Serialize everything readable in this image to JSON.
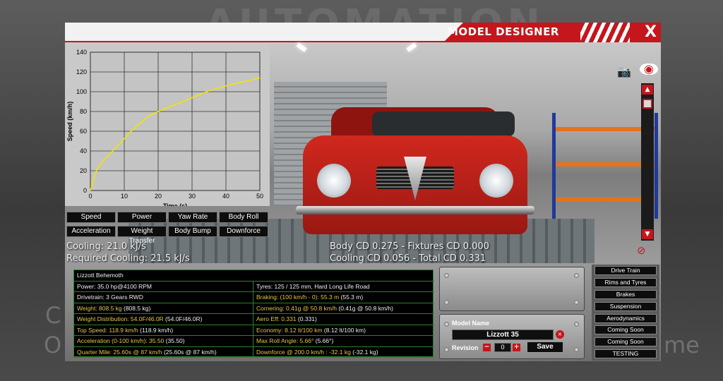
{
  "background": {
    "title": "AUTOMATION",
    "left_fragment_1": "C",
    "left_fragment_2": "O",
    "right_fragment": "me"
  },
  "window": {
    "title": "MODEL DESIGNER",
    "close_label": "X"
  },
  "graph_buttons": [
    "Speed",
    "Power",
    "Yaw Rate",
    "Body Roll",
    "Acceleration",
    "Weight Transfer",
    "Body Bump",
    "Downforce"
  ],
  "stats": {
    "cooling": "Cooling: 21.0 kJ/s",
    "required_cooling": "Required Cooling: 21.5 kJ/s",
    "body_cd": "Body CD 0.275 - Fixtures CD 0.000",
    "cooling_cd": "Cooling CD 0.056 - Total CD 0.331"
  },
  "info": {
    "name": "Lizzott Behemoth",
    "rows": [
      {
        "l_key": "Power:",
        "l_val": " 35.0 hp@4100 RPM",
        "l_hl": false,
        "r_key": "Tyres:",
        "r_val": " 125 / 125 mm, Hard Long Life Road",
        "r_hl": false
      },
      {
        "l_key": "Drivetrain:",
        "l_val": " 3 Gears RWD",
        "l_hl": false,
        "r_key": "Braking: (100 km/h - 0): 55.3 m",
        "r_val": " (55.3 m)",
        "r_hl": true
      },
      {
        "l_key": "Weight: 808.5 kg",
        "l_val": " (808.5 kg)",
        "l_hl": true,
        "r_key": "Cornering: 0.41g @ 50.8 km/h",
        "r_val": " (0.41g @ 50.8 km/h)",
        "r_hl": true
      },
      {
        "l_key": "Weight Distribution: 54.0F/46.0R",
        "l_val": " (54.0F/46.0R)",
        "l_hl": true,
        "r_key": "Aero Eff: 0.331",
        "r_val": " (0.331)",
        "r_hl": true
      },
      {
        "l_key": "Top Speed: 118.9 km/h",
        "l_val": " (118.9 km/h)",
        "l_hl": true,
        "r_key": "Economy: 8.12 lt/100 km",
        "r_val": " (8.12 lt/100 km)",
        "r_hl": true
      },
      {
        "l_key": "Acceleration (0-100 km/h): 35.50",
        "l_val": " (35.50)",
        "l_hl": true,
        "r_key": "Max Roll Angle: 5.66°",
        "r_val": " (5.66°)",
        "r_hl": true
      },
      {
        "l_key": "Quarter Mile: 25.60s @ 87 km/h",
        "l_val": " (25.60s @ 87 km/h)",
        "l_hl": true,
        "r_key": "Downforce @ 200.0 km/h : -32.1 kg",
        "r_val": " (-32.1 kg)",
        "r_hl": true
      }
    ]
  },
  "model": {
    "name_label": "Model Name",
    "name_value": "Lizzott 35",
    "revision_label": "Revision",
    "revision_value": "0",
    "minus": "−",
    "plus": "+",
    "save_label": "Save",
    "clear": "×"
  },
  "right_menu": [
    "Drive Train",
    "Rims and Tyres",
    "Brakes",
    "Suspension",
    "Aerodynamics",
    "Coming Soon",
    "Coming Soon",
    "TESTING"
  ],
  "icons": {
    "camera": "camera-icon",
    "eye": "eye-icon",
    "hide": "hide-icon",
    "scroll_up": "▲",
    "scroll_down": "▼"
  },
  "colors": {
    "accent": "#c4161c",
    "graph_line": "#f2e500",
    "table_key": "#e4c64a",
    "table_border": "#2f7f2f"
  },
  "chart_data": {
    "type": "line",
    "xlabel": "Time (s)",
    "ylabel": "Speed (km/h)",
    "xlim": [
      0,
      50
    ],
    "ylim": [
      0,
      140
    ],
    "xticks": [
      0,
      10,
      20,
      30,
      40,
      50
    ],
    "yticks": [
      0,
      20,
      40,
      60,
      80,
      100,
      120,
      140
    ],
    "grid": true,
    "series": [
      {
        "x": [
          0,
          1,
          2,
          4,
          8,
          12,
          17,
          20,
          25,
          30,
          35,
          40,
          45,
          50
        ],
        "y": [
          0,
          12,
          22,
          31,
          45,
          60,
          75,
          80,
          87,
          94,
          101,
          106,
          110,
          114
        ]
      }
    ]
  }
}
